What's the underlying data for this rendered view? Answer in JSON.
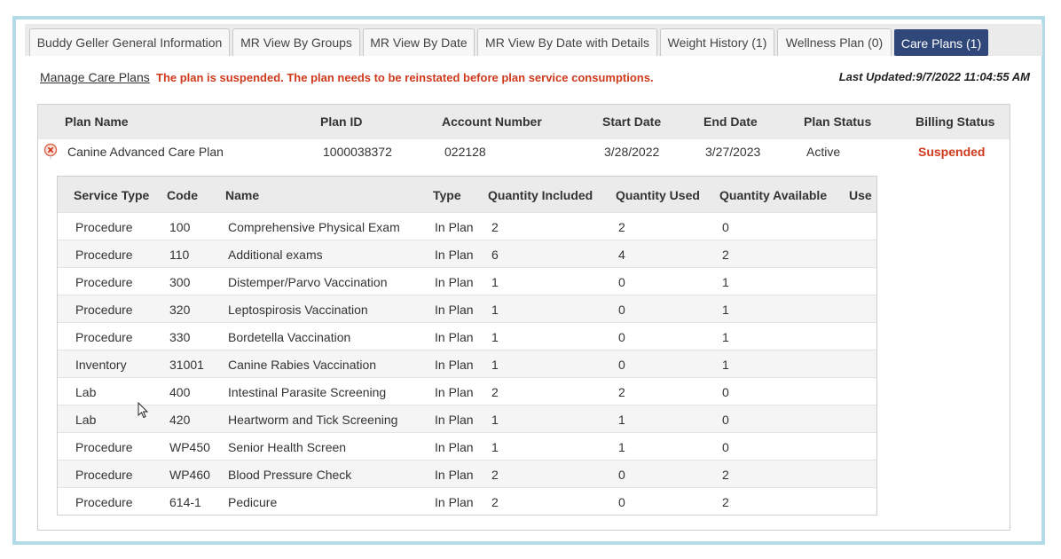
{
  "tabs": [
    {
      "label": "Buddy Geller General Information",
      "active": false
    },
    {
      "label": "MR View By Groups",
      "active": false
    },
    {
      "label": "MR View By Date",
      "active": false
    },
    {
      "label": "MR View By Date with Details",
      "active": false
    },
    {
      "label": "Weight History (1)",
      "active": false
    },
    {
      "label": "Wellness Plan (0)",
      "active": false
    },
    {
      "label": "Care Plans (1)",
      "active": true
    }
  ],
  "toolbar": {
    "manage_link": "Manage Care Plans",
    "warning": "The plan is suspended. The plan needs to be reinstated before plan service consumptions.",
    "last_updated": "Last Updated:9/7/2022 11:04:55 AM"
  },
  "plan_table": {
    "headers": [
      "Plan Name",
      "Plan ID",
      "Account Number",
      "Start Date",
      "End Date",
      "Plan Status",
      "Billing Status"
    ],
    "row": {
      "plan_name": "Canine Advanced Care Plan",
      "plan_id": "1000038372",
      "account_number": "022128",
      "start_date": "3/28/2022",
      "end_date": "3/27/2023",
      "plan_status": "Active",
      "billing_status": "Suspended"
    }
  },
  "services_table": {
    "headers": [
      "Service Type",
      "Code",
      "Name",
      "Type",
      "Quantity Included",
      "Quantity Used",
      "Quantity Available",
      "Use"
    ],
    "rows": [
      {
        "service_type": "Procedure",
        "code": "100",
        "name": "Comprehensive Physical Exam",
        "type": "In Plan",
        "included": "2",
        "used": "2",
        "available": "0"
      },
      {
        "service_type": "Procedure",
        "code": "110",
        "name": "Additional exams",
        "type": "In Plan",
        "included": "6",
        "used": "4",
        "available": "2"
      },
      {
        "service_type": "Procedure",
        "code": "300",
        "name": "Distemper/Parvo Vaccination",
        "type": "In Plan",
        "included": "1",
        "used": "0",
        "available": "1"
      },
      {
        "service_type": "Procedure",
        "code": "320",
        "name": "Leptospirosis Vaccination",
        "type": "In Plan",
        "included": "1",
        "used": "0",
        "available": "1"
      },
      {
        "service_type": "Procedure",
        "code": "330",
        "name": "Bordetella Vaccination",
        "type": "In Plan",
        "included": "1",
        "used": "0",
        "available": "1"
      },
      {
        "service_type": "Inventory",
        "code": "31001",
        "name": "Canine Rabies Vaccination",
        "type": "In Plan",
        "included": "1",
        "used": "0",
        "available": "1"
      },
      {
        "service_type": "Lab",
        "code": "400",
        "name": "Intestinal Parasite Screening",
        "type": "In Plan",
        "included": "2",
        "used": "2",
        "available": "0"
      },
      {
        "service_type": "Lab",
        "code": "420",
        "name": "Heartworm and Tick Screening",
        "type": "In Plan",
        "included": "1",
        "used": "1",
        "available": "0"
      },
      {
        "service_type": "Procedure",
        "code": "WP450",
        "name": "Senior Health Screen",
        "type": "In Plan",
        "included": "1",
        "used": "1",
        "available": "0"
      },
      {
        "service_type": "Procedure",
        "code": "WP460",
        "name": "Blood Pressure Check",
        "type": "In Plan",
        "included": "2",
        "used": "0",
        "available": "2"
      },
      {
        "service_type": "Procedure",
        "code": "614-1",
        "name": "Pedicure",
        "type": "In Plan",
        "included": "2",
        "used": "0",
        "available": "2"
      }
    ]
  },
  "colors": {
    "active_tab": "#2f4779",
    "alert": "#d03a1c",
    "frame_border": "#b5dbe9"
  }
}
